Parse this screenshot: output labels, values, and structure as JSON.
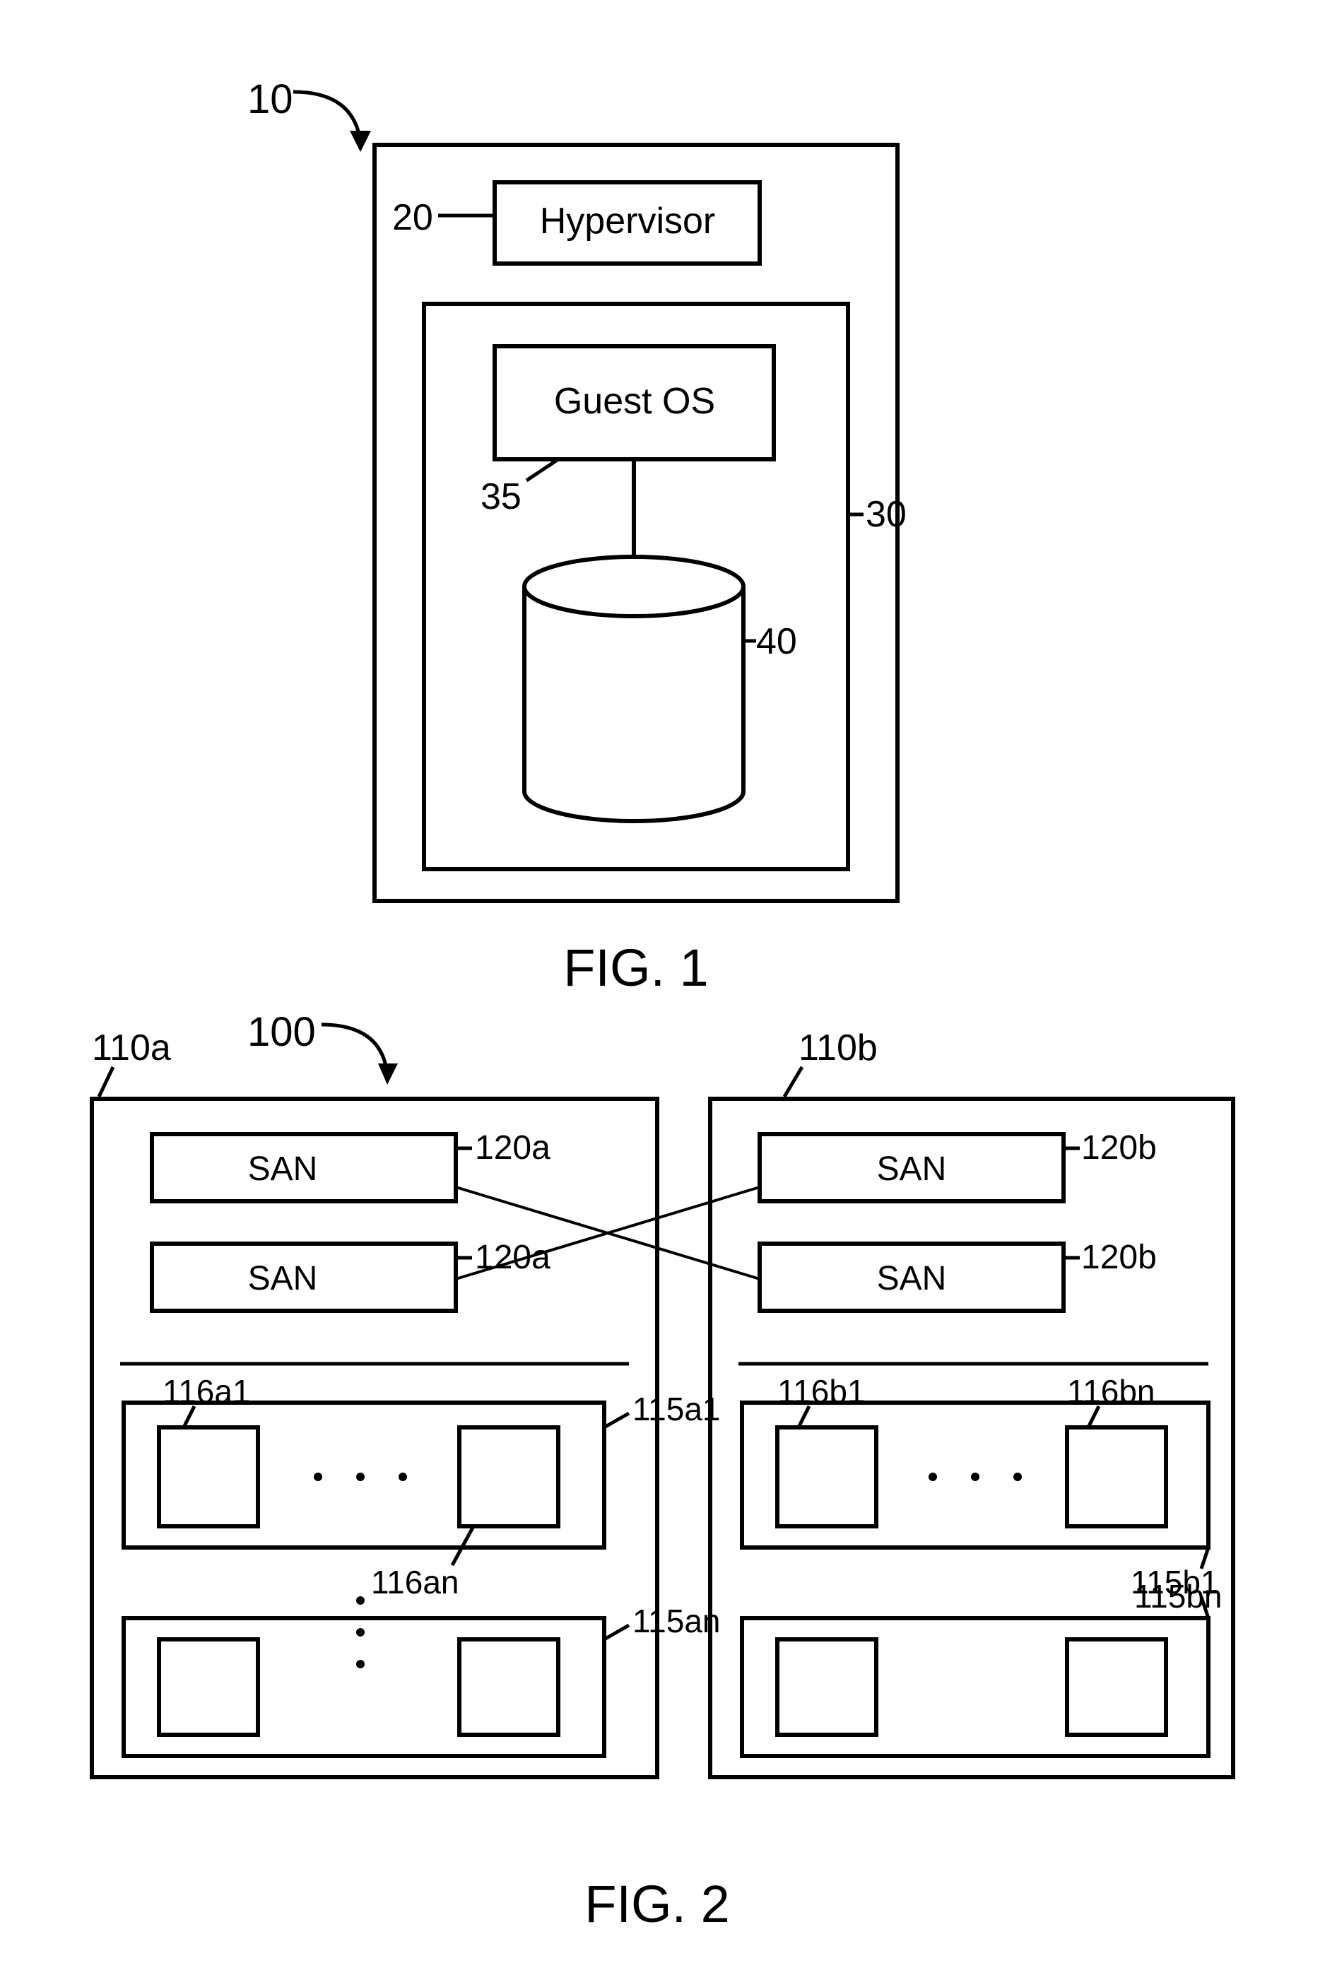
{
  "fig1": {
    "caption": "FIG. 1",
    "labels": {
      "ref10": "10",
      "ref20": "20",
      "ref30": "30",
      "ref35": "35",
      "ref40": "40",
      "hypervisor": "Hypervisor",
      "guestos": "Guest OS"
    }
  },
  "fig2": {
    "caption": "FIG. 2",
    "labels": {
      "ref100": "100",
      "ref110a": "110a",
      "ref110b": "110b",
      "ref120a": "120a",
      "ref120b": "120b",
      "san": "SAN",
      "ref115a1": "115a1",
      "ref115an": "115an",
      "ref115b1": "115b1",
      "ref115bn": "115bn",
      "ref116a1": "116a1",
      "ref116an": "116an",
      "ref116b1": "116b1",
      "ref116bn": "116bn"
    }
  }
}
